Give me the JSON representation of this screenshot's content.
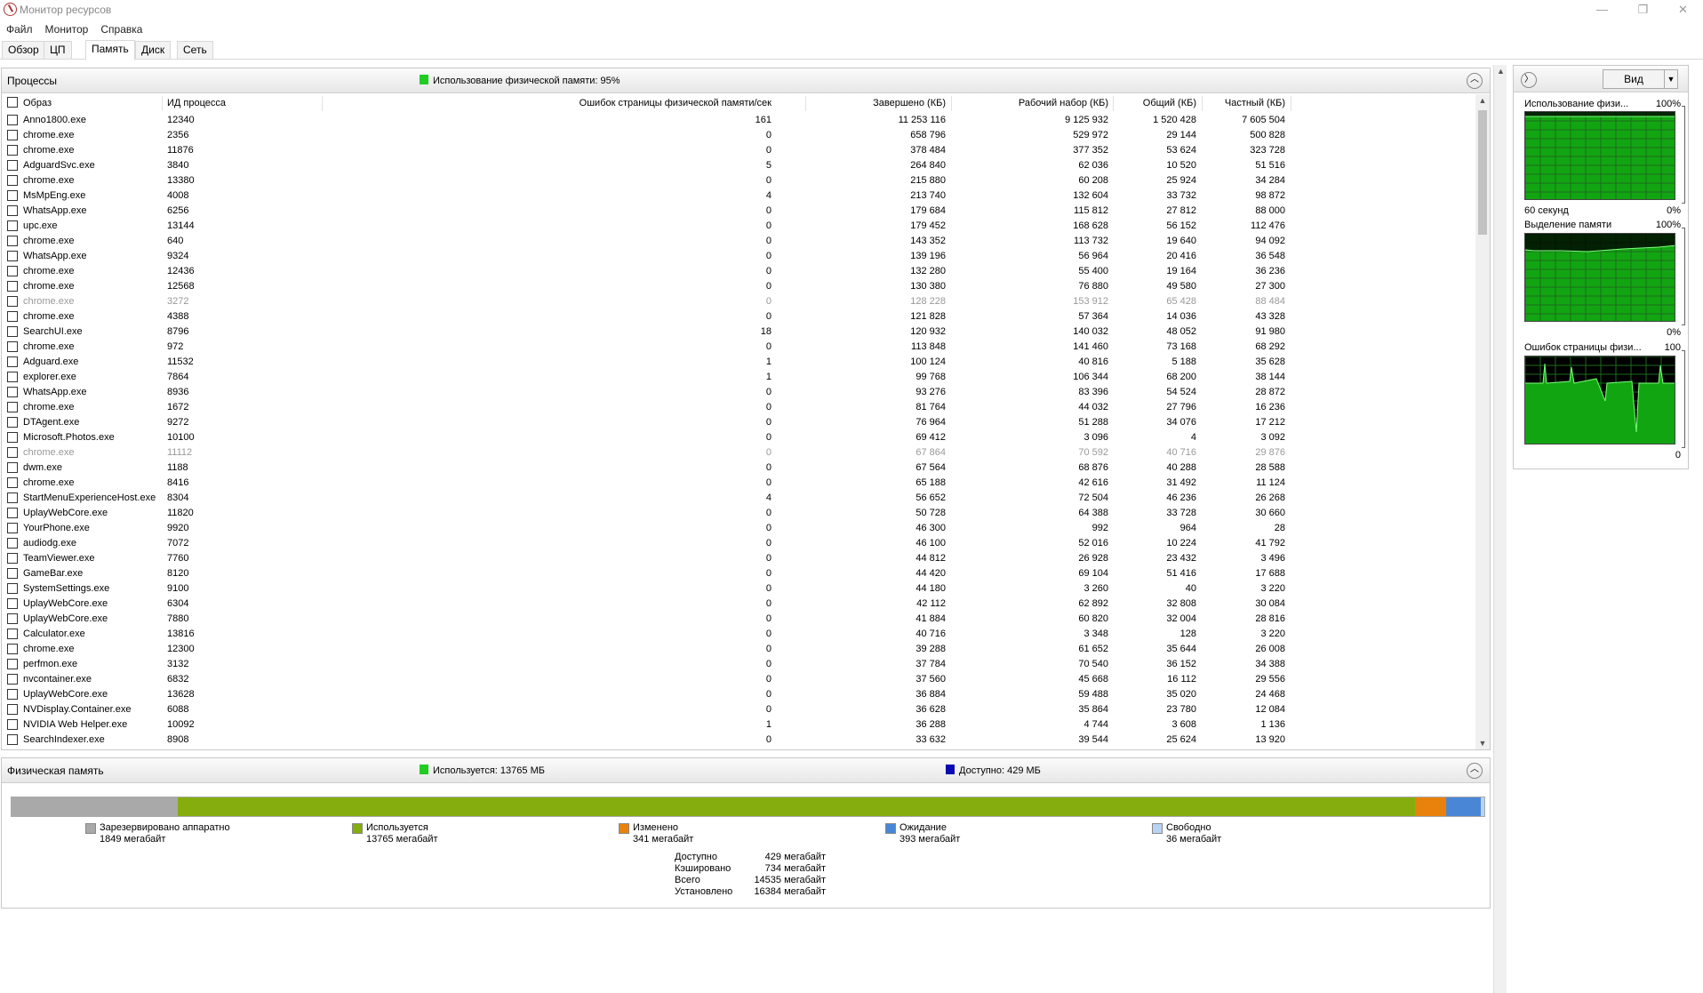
{
  "window": {
    "title": "Монитор ресурсов",
    "controls": {
      "minimize": "—",
      "maximize": "❐",
      "close": "✕"
    }
  },
  "menu": [
    "Файл",
    "Монитор",
    "Справка"
  ],
  "tabs": [
    "Обзор",
    "ЦП",
    "Память",
    "Диск",
    "Сеть"
  ],
  "active_tab": "Память",
  "processes": {
    "title": "Процессы",
    "info": "Использование физической памяти: 95%",
    "info_color": "#22cc22",
    "columns": [
      "Образ",
      "ИД процесса",
      "Ошибок страницы физической памяти/сек",
      "Завершено (КБ)",
      "Рабочий набор (КБ)",
      "Общий (КБ)",
      "Частный (КБ)"
    ],
    "rows": [
      [
        "Anno1800.exe",
        "12340",
        "161",
        "11 253 116",
        "9 125 932",
        "1 520 428",
        "7 605 504",
        false
      ],
      [
        "chrome.exe",
        "2356",
        "0",
        "658 796",
        "529 972",
        "29 144",
        "500 828",
        false
      ],
      [
        "chrome.exe",
        "11876",
        "0",
        "378 484",
        "377 352",
        "53 624",
        "323 728",
        false
      ],
      [
        "AdguardSvc.exe",
        "3840",
        "5",
        "264 840",
        "62 036",
        "10 520",
        "51 516",
        false
      ],
      [
        "chrome.exe",
        "13380",
        "0",
        "215 880",
        "60 208",
        "25 924",
        "34 284",
        false
      ],
      [
        "MsMpEng.exe",
        "4008",
        "4",
        "213 740",
        "132 604",
        "33 732",
        "98 872",
        false
      ],
      [
        "WhatsApp.exe",
        "6256",
        "0",
        "179 684",
        "115 812",
        "27 812",
        "88 000",
        false
      ],
      [
        "upc.exe",
        "13144",
        "0",
        "179 452",
        "168 628",
        "56 152",
        "112 476",
        false
      ],
      [
        "chrome.exe",
        "640",
        "0",
        "143 352",
        "113 732",
        "19 640",
        "94 092",
        false
      ],
      [
        "WhatsApp.exe",
        "9324",
        "0",
        "139 196",
        "56 964",
        "20 416",
        "36 548",
        false
      ],
      [
        "chrome.exe",
        "12436",
        "0",
        "132 280",
        "55 400",
        "19 164",
        "36 236",
        false
      ],
      [
        "chrome.exe",
        "12568",
        "0",
        "130 380",
        "76 880",
        "49 580",
        "27 300",
        false
      ],
      [
        "chrome.exe",
        "3272",
        "0",
        "128 228",
        "153 912",
        "65 428",
        "88 484",
        true
      ],
      [
        "chrome.exe",
        "4388",
        "0",
        "121 828",
        "57 364",
        "14 036",
        "43 328",
        false
      ],
      [
        "SearchUI.exe",
        "8796",
        "18",
        "120 932",
        "140 032",
        "48 052",
        "91 980",
        false
      ],
      [
        "chrome.exe",
        "972",
        "0",
        "113 848",
        "141 460",
        "73 168",
        "68 292",
        false
      ],
      [
        "Adguard.exe",
        "11532",
        "1",
        "100 124",
        "40 816",
        "5 188",
        "35 628",
        false
      ],
      [
        "explorer.exe",
        "7864",
        "1",
        "99 768",
        "106 344",
        "68 200",
        "38 144",
        false
      ],
      [
        "WhatsApp.exe",
        "8936",
        "0",
        "93 276",
        "83 396",
        "54 524",
        "28 872",
        false
      ],
      [
        "chrome.exe",
        "1672",
        "0",
        "81 764",
        "44 032",
        "27 796",
        "16 236",
        false
      ],
      [
        "DTAgent.exe",
        "9272",
        "0",
        "76 964",
        "51 288",
        "34 076",
        "17 212",
        false
      ],
      [
        "Microsoft.Photos.exe",
        "10100",
        "0",
        "69 412",
        "3 096",
        "4",
        "3 092",
        false
      ],
      [
        "chrome.exe",
        "11112",
        "0",
        "67 864",
        "70 592",
        "40 716",
        "29 876",
        true
      ],
      [
        "dwm.exe",
        "1188",
        "0",
        "67 564",
        "68 876",
        "40 288",
        "28 588",
        false
      ],
      [
        "chrome.exe",
        "8416",
        "0",
        "65 188",
        "42 616",
        "31 492",
        "11 124",
        false
      ],
      [
        "StartMenuExperienceHost.exe",
        "8304",
        "4",
        "56 652",
        "72 504",
        "46 236",
        "26 268",
        false
      ],
      [
        "UplayWebCore.exe",
        "11820",
        "0",
        "50 728",
        "64 388",
        "33 728",
        "30 660",
        false
      ],
      [
        "YourPhone.exe",
        "9920",
        "0",
        "46 300",
        "992",
        "964",
        "28",
        false
      ],
      [
        "audiodg.exe",
        "7072",
        "0",
        "46 100",
        "52 016",
        "10 224",
        "41 792",
        false
      ],
      [
        "TeamViewer.exe",
        "7760",
        "0",
        "44 812",
        "26 928",
        "23 432",
        "3 496",
        false
      ],
      [
        "GameBar.exe",
        "8120",
        "0",
        "44 420",
        "69 104",
        "51 416",
        "17 688",
        false
      ],
      [
        "SystemSettings.exe",
        "9100",
        "0",
        "44 180",
        "3 260",
        "40",
        "3 220",
        false
      ],
      [
        "UplayWebCore.exe",
        "6304",
        "0",
        "42 112",
        "62 892",
        "32 808",
        "30 084",
        false
      ],
      [
        "UplayWebCore.exe",
        "7880",
        "0",
        "41 884",
        "60 820",
        "32 004",
        "28 816",
        false
      ],
      [
        "Calculator.exe",
        "13816",
        "0",
        "40 716",
        "3 348",
        "128",
        "3 220",
        false
      ],
      [
        "chrome.exe",
        "12300",
        "0",
        "39 288",
        "61 652",
        "35 644",
        "26 008",
        false
      ],
      [
        "perfmon.exe",
        "3132",
        "0",
        "37 784",
        "70 540",
        "36 152",
        "34 388",
        false
      ],
      [
        "nvcontainer.exe",
        "6832",
        "0",
        "37 560",
        "45 668",
        "16 112",
        "29 556",
        false
      ],
      [
        "UplayWebCore.exe",
        "13628",
        "0",
        "36 884",
        "59 488",
        "35 020",
        "24 468",
        false
      ],
      [
        "NVDisplay.Container.exe",
        "6088",
        "0",
        "36 628",
        "35 864",
        "23 780",
        "12 084",
        false
      ],
      [
        "NVIDIA Web Helper.exe",
        "10092",
        "1",
        "36 288",
        "4 744",
        "3 608",
        "1 136",
        false
      ],
      [
        "SearchIndexer.exe",
        "8908",
        "0",
        "33 632",
        "39 544",
        "25 624",
        "13 920",
        false
      ]
    ]
  },
  "physical_memory": {
    "title": "Физическая память",
    "used_info": "Используется: 13765 МБ",
    "available_info": "Доступно: 429 МБ",
    "used_color": "#22cc22",
    "available_color": "#0a0ab4",
    "segments": [
      {
        "label": "Зарезервировано аппаратно",
        "value": "1849 мегабайт",
        "mb": 1849,
        "color": "#a9a9a9"
      },
      {
        "label": "Используется",
        "value": "13765 мегабайт",
        "mb": 13765,
        "color": "#86ad0e"
      },
      {
        "label": "Изменено",
        "value": "341 мегабайт",
        "mb": 341,
        "color": "#e8820c"
      },
      {
        "label": "Ожидание",
        "value": "393 мегабайт",
        "mb": 393,
        "color": "#4a86d6"
      },
      {
        "label": "Свободно",
        "value": "36 мегабайт",
        "mb": 36,
        "color": "#b9d3f2"
      }
    ],
    "stats": [
      {
        "label": "Доступно",
        "value": "429 мегабайт"
      },
      {
        "label": "Кэшировано",
        "value": "734 мегабайт"
      },
      {
        "label": "Всего",
        "value": "14535 мегабайт"
      },
      {
        "label": "Установлено",
        "value": "16384 мегабайт"
      }
    ]
  },
  "side": {
    "view_label": "Вид",
    "graphs": [
      {
        "title": "Использование физи...",
        "max": "100%",
        "footer_left": "60 секунд",
        "footer_right": "0%"
      },
      {
        "title": "Выделение памяти",
        "max": "100%",
        "footer_left": "",
        "footer_right": "0%"
      },
      {
        "title": "Ошибок страницы физи...",
        "max": "100",
        "footer_left": "",
        "footer_right": "0"
      }
    ]
  }
}
